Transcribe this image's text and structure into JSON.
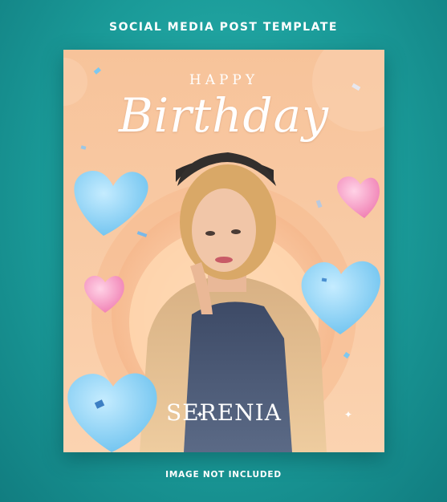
{
  "header": {
    "title": "SOCIAL MEDIA POST TEMPLATE"
  },
  "card": {
    "happy": "HAPPY",
    "birthday": "Birthday",
    "name": "SERENIA"
  },
  "footer": {
    "note": "IMAGE NOT INCLUDED"
  },
  "colors": {
    "teal_background": "#1a9a98",
    "peach": "#f7c39a",
    "heart_blue": "#8fd3f5",
    "heart_pink": "#f59bc4"
  }
}
